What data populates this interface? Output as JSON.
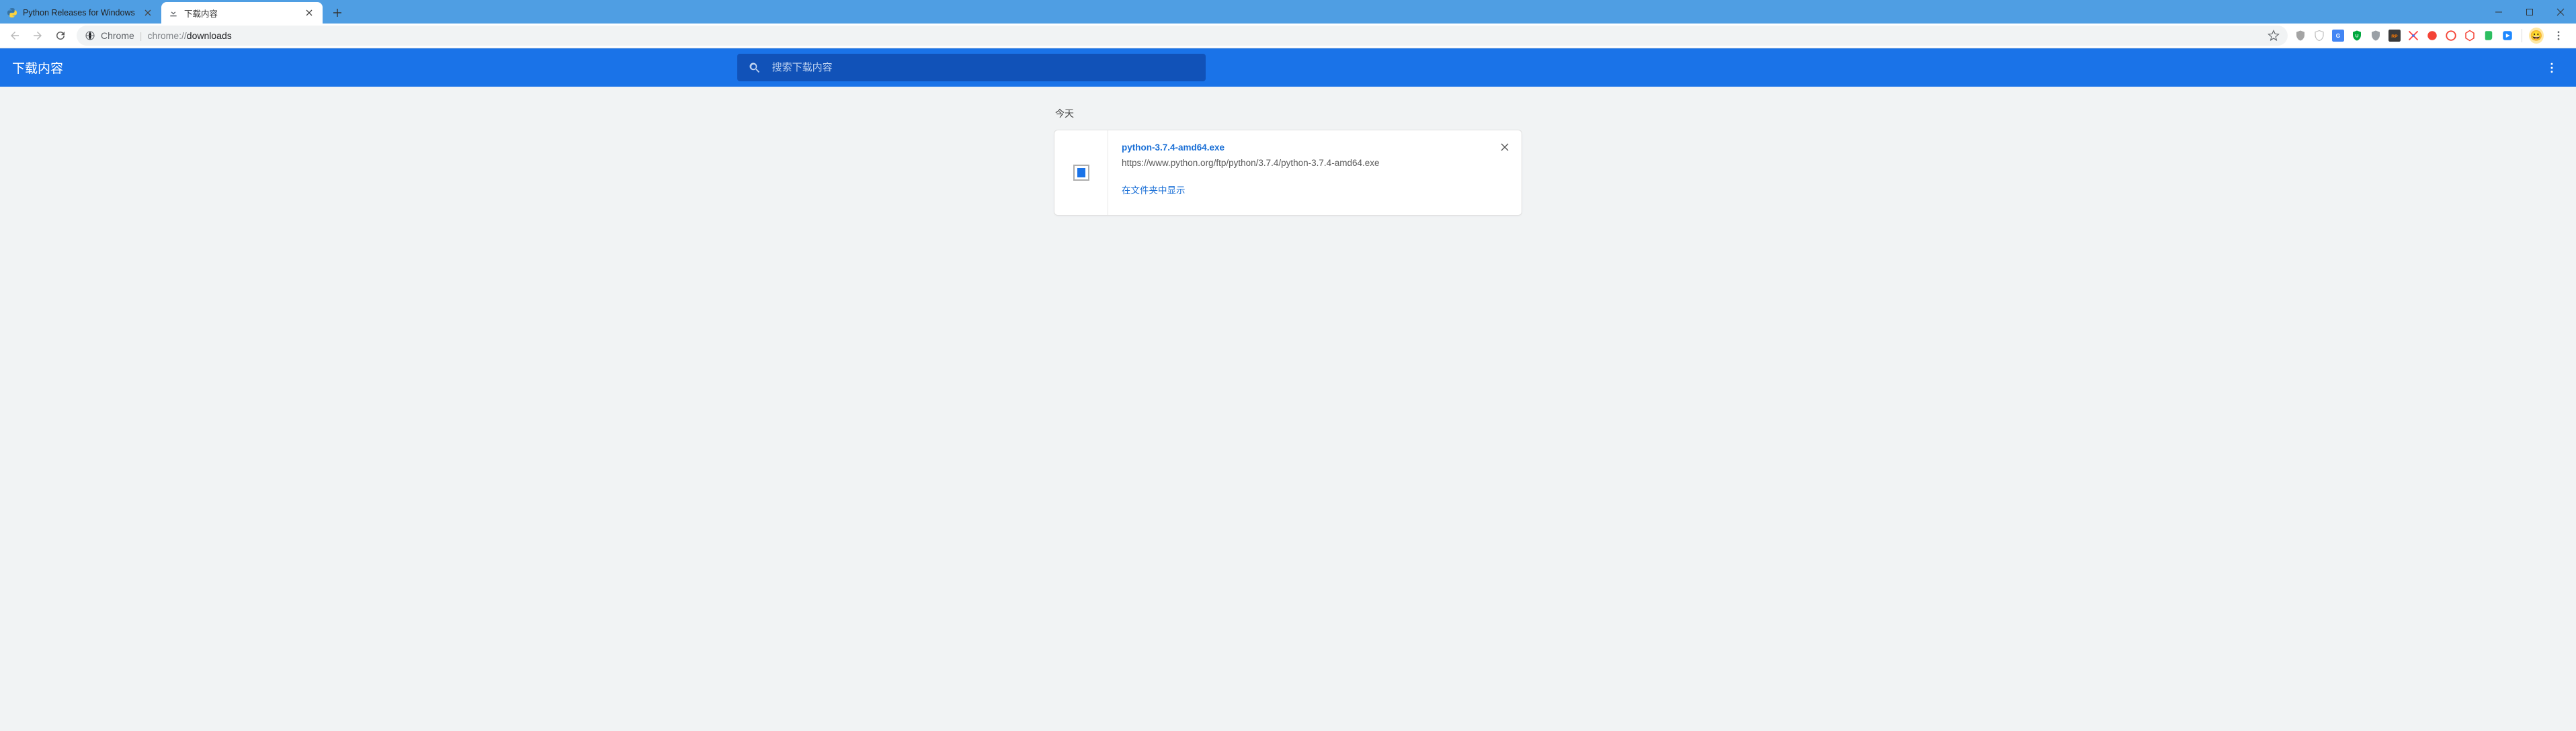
{
  "tabs": [
    {
      "title": "Python Releases for Windows",
      "favicon": "python-icon"
    },
    {
      "title": "下载内容",
      "favicon": "download-icon"
    }
  ],
  "activeTabIndex": 1,
  "browser": {
    "name": "Chrome",
    "url_dim": "chrome://",
    "url_strong": "downloads"
  },
  "extensions": [
    {
      "name": "shield-gray-icon",
      "color": "#a4a4a4"
    },
    {
      "name": "shield-outline-icon",
      "color": "#bdbdbd"
    },
    {
      "name": "gtranslate-icon",
      "color": "#4285f4"
    },
    {
      "name": "ublock-icon",
      "color": "#00a73e"
    },
    {
      "name": "shield-dark-icon",
      "color": "#9aa0a6"
    },
    {
      "name": "rp-icon",
      "color": "#3a3a3a"
    },
    {
      "name": "xmind-icon",
      "color": "#ff3e3e"
    },
    {
      "name": "circle-red1-icon",
      "color": "#f44336"
    },
    {
      "name": "circle-red2-icon",
      "color": "#f44336"
    },
    {
      "name": "hex-red-icon",
      "color": "#f44336"
    },
    {
      "name": "evernote-icon",
      "color": "#2dbe60"
    },
    {
      "name": "blue-square-icon",
      "color": "#1e88ff"
    }
  ],
  "downloadsPage": {
    "title": "下载内容",
    "searchPlaceholder": "搜索下载内容",
    "sectionLabel": "今天",
    "menuTooltip": "更多操作"
  },
  "downloads": [
    {
      "filename": "python-3.7.4-amd64.exe",
      "url": "https://www.python.org/ftp/python/3.7.4/python-3.7.4-amd64.exe",
      "actionLabel": "在文件夹中显示"
    }
  ]
}
